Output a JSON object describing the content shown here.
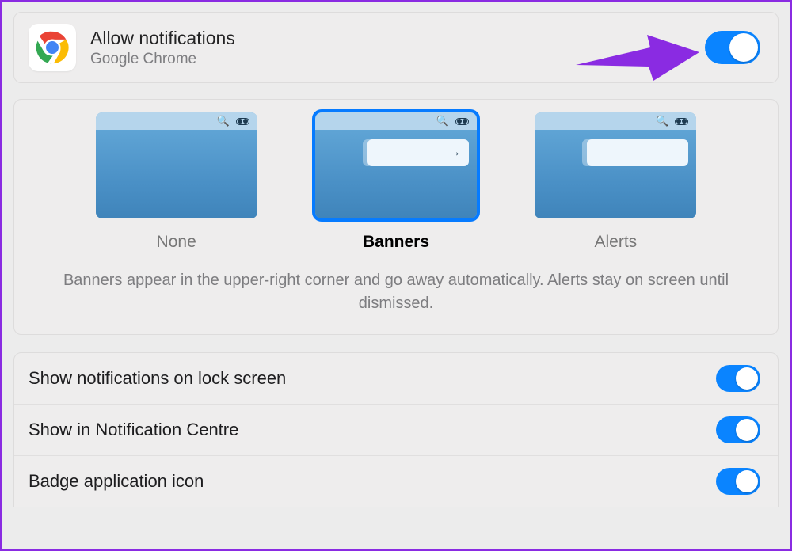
{
  "header": {
    "title": "Allow notifications",
    "subtitle": "Google Chrome",
    "toggle_on": true
  },
  "alert_styles": {
    "options": [
      {
        "label": "None",
        "selected": false,
        "has_banner": false,
        "banner_glyph": ""
      },
      {
        "label": "Banners",
        "selected": true,
        "has_banner": true,
        "banner_glyph": "→"
      },
      {
        "label": "Alerts",
        "selected": false,
        "has_banner": true,
        "banner_glyph": ""
      }
    ],
    "description": "Banners appear in the upper-right corner and go away automatically. Alerts stay on screen until dismissed."
  },
  "settings": [
    {
      "label": "Show notifications on lock screen",
      "on": true
    },
    {
      "label": "Show in Notification Centre",
      "on": true
    },
    {
      "label": "Badge application icon",
      "on": true
    }
  ],
  "colors": {
    "accent": "#0a84ff",
    "annotation": "#8a2be2"
  },
  "icons": {
    "chrome": "chrome-icon",
    "search": "search-icon",
    "control_centre": "control-centre-icon",
    "arrow_right": "arrow-right-icon"
  }
}
